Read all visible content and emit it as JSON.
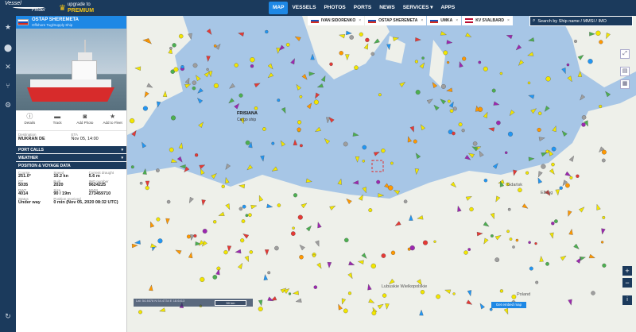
{
  "brand": {
    "logo_line1": "Vessel",
    "logo_line2": "Finder",
    "upgrade_line": "upgrade to",
    "upgrade_plan": "PREMIUM"
  },
  "nav": [
    "MAP",
    "VESSELS",
    "PHOTOS",
    "PORTS",
    "NEWS",
    "SERVICES ▾",
    "APPS"
  ],
  "ship": {
    "name": "OSTAP SHEREMETA",
    "type": "Offshore Tug/Supply Ship",
    "actions": [
      "Details",
      "Track",
      "Add Photo",
      "Add to Fleet"
    ],
    "destination_label": "Destination",
    "destination": "MUKRAN DE",
    "eta_label": "ETA",
    "eta": "Nov 05, 14:00",
    "sections": [
      "PORT CALLS",
      "WEATHER",
      "POSITION & VOYAGE DATA"
    ],
    "voyage": [
      [
        {
          "l": "Course",
          "v": "251.0°"
        },
        {
          "l": "Speed",
          "v": "10.2 kn"
        },
        {
          "l": "Current draught",
          "v": "5.6 m"
        }
      ],
      [
        {
          "l": "GT",
          "v": "5035"
        },
        {
          "l": "Built",
          "v": "2020"
        },
        {
          "l": "IMO number",
          "v": "9624225"
        }
      ],
      [
        {
          "l": "DWT",
          "v": "4014"
        },
        {
          "l": "Size",
          "v": "90 / 19m"
        },
        {
          "l": "MMSI",
          "v": "273459710"
        }
      ]
    ],
    "status_label": "Status",
    "status": "Under way",
    "pos_label": "Position received",
    "pos": "0 min (Nov 05, 2020 08:32 UTC)"
  },
  "tabs": [
    "IVAN SIDORENKO",
    "OSTAP SHEREMETA",
    "UMKA",
    "KV SVALBARD"
  ],
  "search_placeholder": "Search by Ship name / MMSI / IMO",
  "map_labels": [
    {
      "t": "FRISIANA",
      "bold": true
    },
    {
      "t": "Cargo ship",
      "bold": false
    }
  ],
  "countries": [
    {
      "t": "Poland"
    },
    {
      "t": "Gdańsk"
    },
    {
      "t": "Elbląg"
    },
    {
      "t": "Lubuskie Wielkopolskie"
    }
  ],
  "coords_text": "Lat: 54.4678   N 54.4734   E 18.6413",
  "scale_text": "50 km",
  "embed_label": "Get embed map",
  "colors": {
    "navy": "#1b3a5c",
    "blue": "#1e88e5",
    "sea": "#a7c6e6",
    "land": "#eef0ea"
  }
}
